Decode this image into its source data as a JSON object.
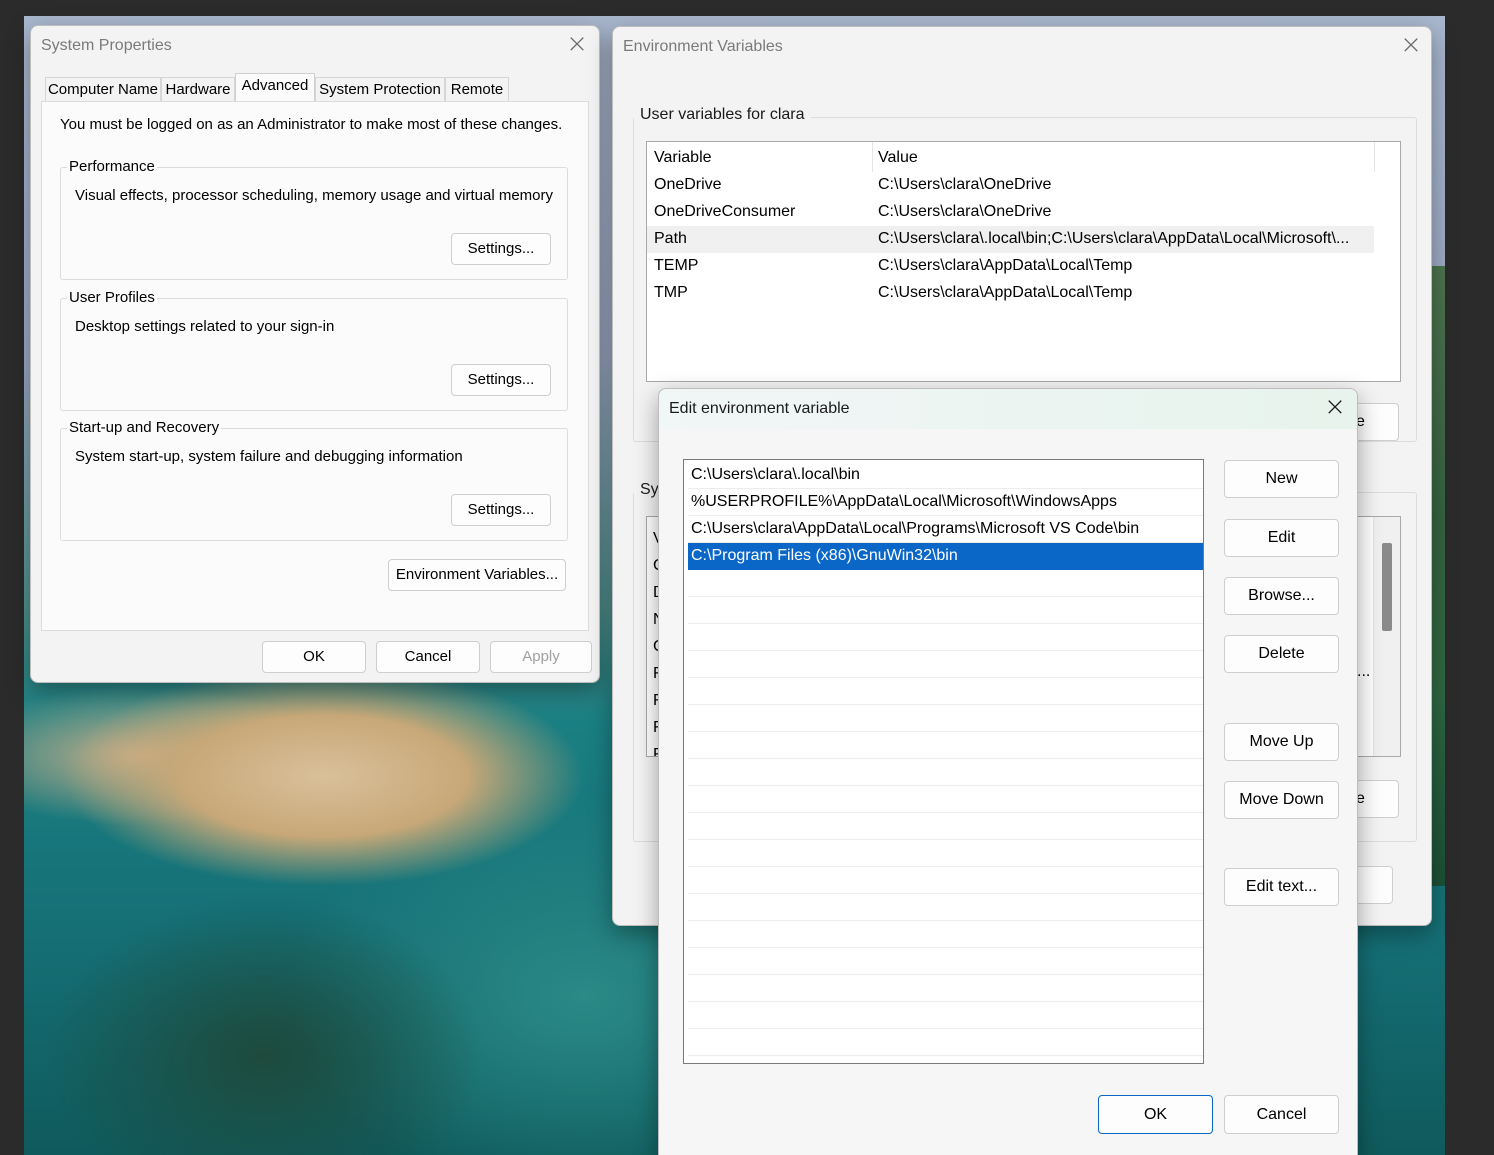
{
  "system_properties": {
    "title": "System Properties",
    "tabs": [
      "Computer Name",
      "Hardware",
      "Advanced",
      "System Protection",
      "Remote"
    ],
    "active_tab": "Advanced",
    "admin_note": "You must be logged on as an Administrator to make most of these changes.",
    "performance": {
      "title": "Performance",
      "description": "Visual effects, processor scheduling, memory usage and virtual memory",
      "settings_label": "Settings..."
    },
    "user_profiles": {
      "title": "User Profiles",
      "description": "Desktop settings related to your sign-in",
      "settings_label": "Settings..."
    },
    "startup_recovery": {
      "title": "Start-up and Recovery",
      "description": "System start-up, system failure and debugging information",
      "settings_label": "Settings..."
    },
    "env_vars_label": "Environment Variables...",
    "ok_label": "OK",
    "cancel_label": "Cancel",
    "apply_label": "Apply"
  },
  "environment_variables": {
    "title": "Environment Variables",
    "user_section_title": "User variables for clara",
    "columns": [
      "Variable",
      "Value"
    ],
    "user_vars": [
      {
        "name": "OneDrive",
        "value": "C:\\Users\\clara\\OneDrive"
      },
      {
        "name": "OneDriveConsumer",
        "value": "C:\\Users\\clara\\OneDrive"
      },
      {
        "name": "Path",
        "value": "C:\\Users\\clara\\.local\\bin;C:\\Users\\clara\\AppData\\Local\\Microsoft\\..."
      },
      {
        "name": "TEMP",
        "value": "C:\\Users\\clara\\AppData\\Local\\Temp"
      },
      {
        "name": "TMP",
        "value": "C:\\Users\\clara\\AppData\\Local\\Temp"
      }
    ],
    "system_section_title_partial": "Sys",
    "system_vars_partial": [
      "V",
      "C",
      "D",
      "N",
      "C",
      "F",
      "F",
      "F",
      "F"
    ],
    "partial_button_right_top": "e",
    "partial_button_right_bottom": "e",
    "partial_ellipsis": "..."
  },
  "edit_env_var": {
    "title": "Edit environment variable",
    "paths": [
      "C:\\Users\\clara\\.local\\bin",
      "%USERPROFILE%\\AppData\\Local\\Microsoft\\WindowsApps",
      "C:\\Users\\clara\\AppData\\Local\\Programs\\Microsoft VS Code\\bin",
      "C:\\Program Files (x86)\\GnuWin32\\bin"
    ],
    "selected_index": 3,
    "buttons": {
      "new": "New",
      "edit": "Edit",
      "browse": "Browse...",
      "delete": "Delete",
      "move_up": "Move Up",
      "move_down": "Move Down",
      "edit_text": "Edit text...",
      "ok": "OK",
      "cancel": "Cancel"
    }
  },
  "colors": {
    "selection": "#0a67c8",
    "ok_button_border": "#0a67c8",
    "window_bg": "#f3f3f3"
  }
}
